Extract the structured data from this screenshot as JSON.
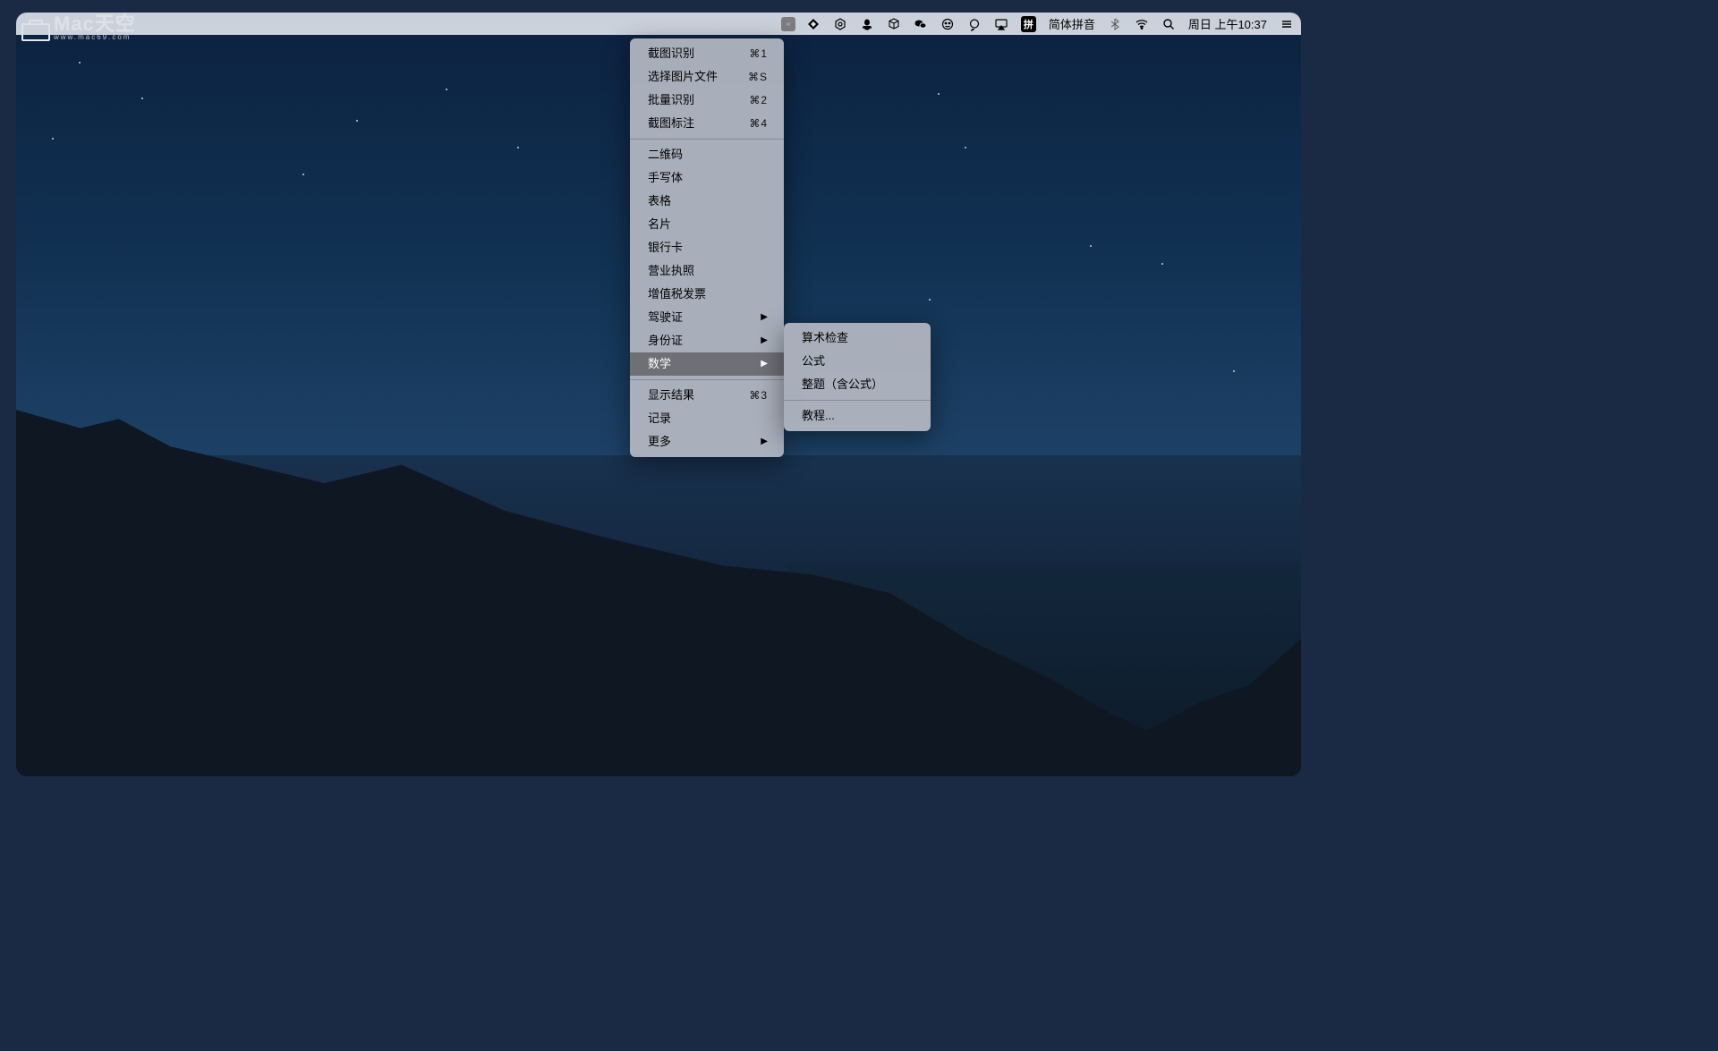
{
  "watermark": {
    "big": "Mac天空",
    "small": "www.mac69.com"
  },
  "menubar": {
    "input_method_icon": "拼",
    "input_method_label": "简体拼音",
    "datetime": "周日 上午10:37"
  },
  "dropdown": {
    "group1": [
      {
        "label": "截图识别",
        "shortcut": "⌘1"
      },
      {
        "label": "选择图片文件",
        "shortcut": "⌘S"
      },
      {
        "label": "批量识别",
        "shortcut": "⌘2"
      },
      {
        "label": "截图标注",
        "shortcut": "⌘4"
      }
    ],
    "group2": [
      {
        "label": "二维码"
      },
      {
        "label": "手写体"
      },
      {
        "label": "表格"
      },
      {
        "label": "名片"
      },
      {
        "label": "银行卡"
      },
      {
        "label": "营业执照"
      },
      {
        "label": "增值税发票"
      },
      {
        "label": "驾驶证",
        "submenu": true
      },
      {
        "label": "身份证",
        "submenu": true
      },
      {
        "label": "数学",
        "submenu": true,
        "highlighted": true
      }
    ],
    "group3": [
      {
        "label": "显示结果",
        "shortcut": "⌘3"
      },
      {
        "label": "记录"
      },
      {
        "label": "更多",
        "submenu": true
      }
    ]
  },
  "submenu": {
    "items": [
      {
        "label": "算术检查"
      },
      {
        "label": "公式"
      },
      {
        "label": "整题（含公式）"
      }
    ],
    "footer": {
      "label": "教程..."
    }
  }
}
